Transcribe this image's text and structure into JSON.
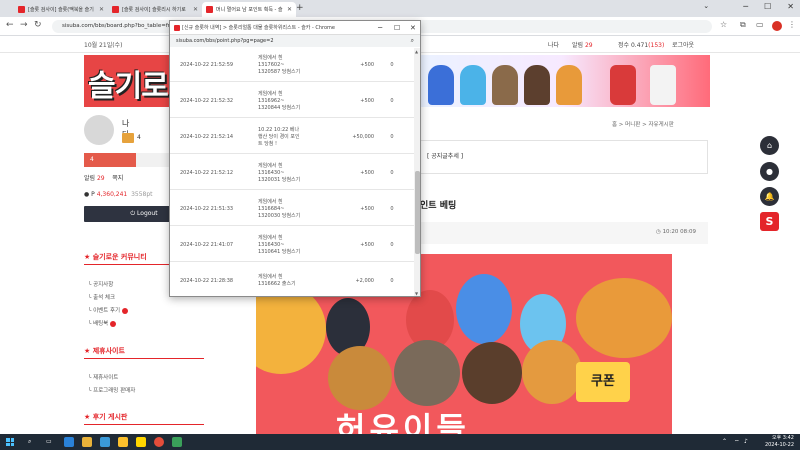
{
  "browser": {
    "tabs": [
      {
        "title": "[슬롯 검사이] 슬롯(맥북을 슬기"
      },
      {
        "title": "[슬롯 검사이] 슬롯리시 하기로 "
      },
      {
        "title": "머니 멀어요 남 포인트 획득 - 슬"
      }
    ],
    "new_tab": "+",
    "address": "sisuba.com/bbs/board.php?bo_table=free",
    "window_controls": {
      "minimize": "─",
      "maximize": "☐",
      "close": "✕",
      "dropdown": "⌄"
    }
  },
  "page": {
    "date": "10월 21일(수)",
    "top_links": [
      "나다",
      "알림",
      "29",
      "정수",
      "0.471",
      "(153)",
      "로그아웃"
    ],
    "logo_text": "슬기로",
    "profile": {
      "name": "나다",
      "level_badge": "4"
    },
    "red_tab": "4",
    "stats": {
      "label1": "알림",
      "val1": "29",
      "label2": "쪽지"
    },
    "points": {
      "prefix": "P",
      "value": "4,360,241",
      "suffix": "3558pt"
    },
    "logout": "Logout",
    "sections": [
      {
        "title": "슬기로운 커뮤니티",
        "items": [
          "공지사항",
          "출석 체크",
          "이벤트 후기",
          "배팅북"
        ]
      },
      {
        "title": "제휴사이트",
        "items": [
          "제휴사이트",
          "프로그래밍 판매자"
        ]
      },
      {
        "title": "후기 게시판",
        "items": []
      }
    ],
    "breadcrumb": "홈 > 머니판 > 자유게시판",
    "notice": "[ 공지글추세 ]",
    "post_title": "인트 베팅",
    "post_time": "10:20 08:09",
    "coupon": "쿠폰",
    "event_text": "허유이들"
  },
  "fabs": {
    "top": "⌂",
    "user": "●",
    "bell": "🔔",
    "s": "S"
  },
  "popup": {
    "title": "[신규 슬롯하 내역] > 슬롯리얼톱 대물 슬롯하위리스트 - 슬카 - Chrome",
    "url": "sisuba.com/bbs/point.php?pg=page=2",
    "zoom": "⌕",
    "rows": [
      {
        "time": "2024-10-22 21:52:59",
        "desc": "게임에서 흰\n1317602~\n1320587 당첨스기",
        "point": "+500",
        "balance": "0"
      },
      {
        "time": "2024-10-22 21:52:32",
        "desc": "게임에서 흰\n1316962~\n1320844 당첨스기",
        "point": "+500",
        "balance": "0"
      },
      {
        "time": "2024-10-22 21:52:14",
        "desc": "10.22 10:22 베나\n행산 당이 경이 포인\n트 당첨 !",
        "point": "+50,000",
        "balance": "0"
      },
      {
        "time": "2024-10-22 21:52:12",
        "desc": "게임에서 흰\n1316430~\n1320031 당첨스기",
        "point": "+500",
        "balance": "0"
      },
      {
        "time": "2024-10-22 21:51:33",
        "desc": "게임에서 흰\n1316684~\n1320030 당첨스기",
        "point": "+500",
        "balance": "0"
      },
      {
        "time": "2024-10-22 21:41:07",
        "desc": "게임에서 흰\n1316430~\n1310641 당첨스기",
        "point": "+500",
        "balance": "0"
      },
      {
        "time": "2024-10-22 21:28:38",
        "desc": "게임에서 흰\n1316662 출스기",
        "point": "+2,000",
        "balance": "0"
      }
    ]
  },
  "taskbar": {
    "time": "오후 3:42",
    "date": "2024-10-22"
  },
  "colors": {
    "accent": "#e4252a",
    "banner": "#e74545",
    "dark": "#2c2f38"
  }
}
